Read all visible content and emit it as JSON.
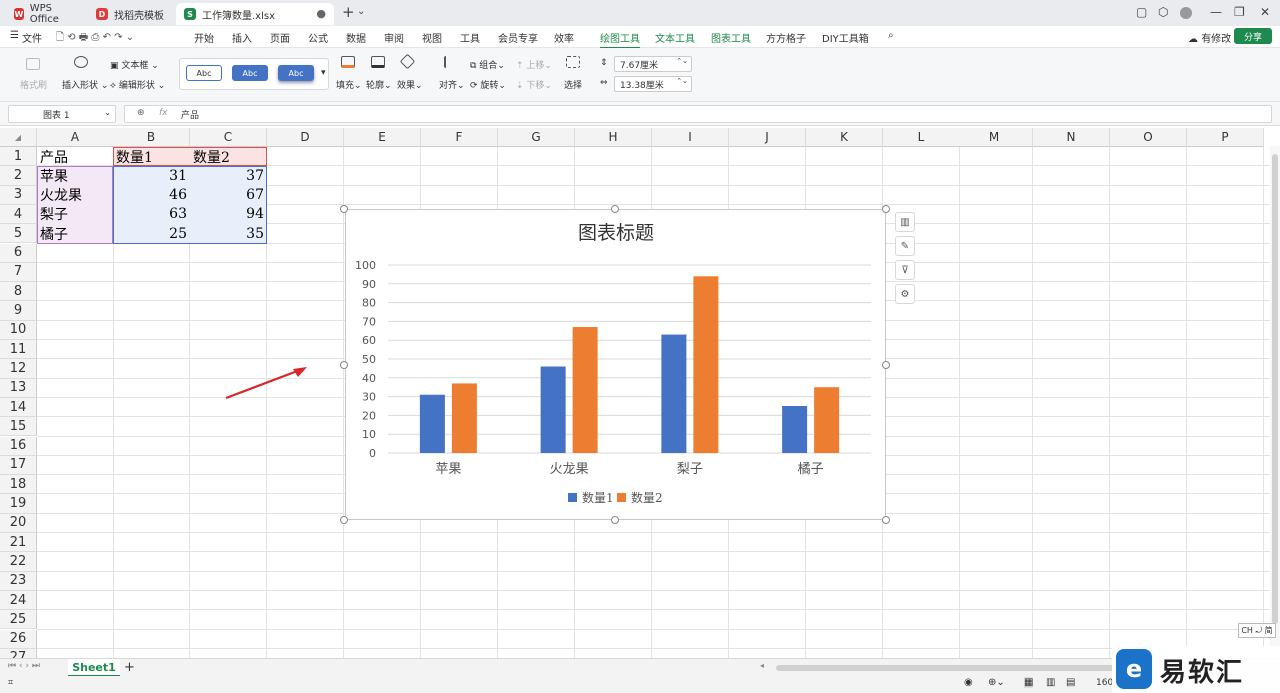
{
  "tabs": [
    {
      "label": "WPS Office",
      "icon": "wps-logo-icon",
      "color": "#d63333"
    },
    {
      "label": "找稻壳模板",
      "icon": "docer-icon",
      "color": "#e03b3b"
    },
    {
      "label": "工作簿数量.xlsx",
      "icon": "spreadsheet-icon",
      "color": "#1e8a4d"
    }
  ],
  "titlebar": {
    "new_tab": "+",
    "dropdown": "⌄"
  },
  "menu": {
    "file": "文件",
    "items": [
      "开始",
      "插入",
      "页面",
      "公式",
      "数据",
      "审阅",
      "视图",
      "工具",
      "会员专享",
      "效率"
    ],
    "context_items": [
      "绘图工具",
      "文本工具",
      "图表工具",
      "方方格子",
      "DIY工具箱"
    ],
    "has_changes": "有修改",
    "share": "分享"
  },
  "ribbon": {
    "format_painter": "格式刷",
    "insert_shape": "插入形状",
    "text_box": "文本框",
    "edit_shape": "编辑形状",
    "style_samples": [
      "Abc",
      "Abc",
      "Abc"
    ],
    "fill": "填充",
    "outline": "轮廓",
    "effect": "效果",
    "align": "对齐",
    "group": "组合",
    "rotate": "旋转",
    "bring_forward": "上移",
    "send_backward": "下移",
    "select": "选择",
    "height": "7.67厘米",
    "width": "13.38厘米"
  },
  "formula_bar": {
    "name_box": "图表 1",
    "fx": "fx",
    "content": "产品"
  },
  "columns": [
    "A",
    "B",
    "C",
    "D",
    "E",
    "F",
    "G",
    "H",
    "I",
    "J",
    "K",
    "L",
    "M",
    "N",
    "O",
    "P"
  ],
  "rows": [
    "1",
    "2",
    "3",
    "4",
    "5",
    "6",
    "7",
    "8",
    "9",
    "10",
    "11",
    "12",
    "13",
    "14",
    "15",
    "16",
    "17",
    "18",
    "19",
    "20",
    "21",
    "22",
    "23",
    "24",
    "25",
    "26",
    "27"
  ],
  "table": {
    "header": [
      "产品",
      "数量1",
      "数量2"
    ],
    "rows": [
      [
        "苹果",
        "31",
        "37"
      ],
      [
        "火龙果",
        "46",
        "67"
      ],
      [
        "梨子",
        "63",
        "94"
      ],
      [
        "橘子",
        "25",
        "35"
      ]
    ]
  },
  "colors": {
    "series1": "#4472c4",
    "series2": "#ed7d31",
    "accent": "#1e8a4d",
    "arrow": "#d9262b"
  },
  "chart_data": {
    "type": "bar",
    "title": "图表标题",
    "categories": [
      "苹果",
      "火龙果",
      "梨子",
      "橘子"
    ],
    "series": [
      {
        "name": "数量1",
        "values": [
          31,
          46,
          63,
          25
        ],
        "color": "#4472c4"
      },
      {
        "name": "数量2",
        "values": [
          37,
          67,
          94,
          35
        ],
        "color": "#ed7d31"
      }
    ],
    "ylim": [
      0,
      100
    ],
    "yticks": [
      0,
      10,
      20,
      30,
      40,
      50,
      60,
      70,
      80,
      90,
      100
    ],
    "grid": true,
    "legend": "bottom"
  },
  "sheets": {
    "active": "Sheet1",
    "add": "+"
  },
  "status": {
    "zoom": "160",
    "ime": "CH ⤾ 简"
  },
  "watermark": "易软汇"
}
